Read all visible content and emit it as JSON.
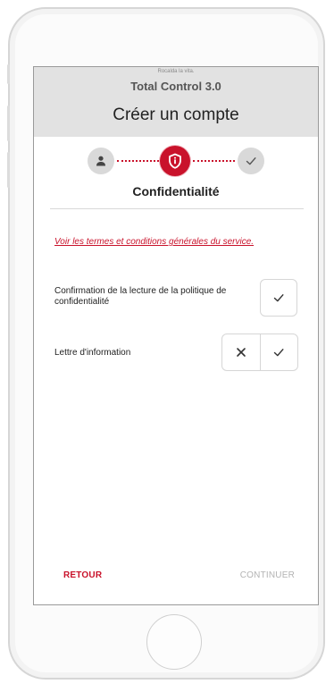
{
  "status_bar": {
    "text": "Rocalda la vita."
  },
  "app": {
    "title": "Total Control 3.0"
  },
  "page": {
    "title": "Créer un compte"
  },
  "stepper": {
    "steps": [
      {
        "icon": "user-icon",
        "state": "done"
      },
      {
        "icon": "shield-icon",
        "state": "active"
      },
      {
        "icon": "check-icon",
        "state": "pending"
      }
    ],
    "current_label": "Confidentialité"
  },
  "terms": {
    "link_text": "Voir les termes et conditions générales du service."
  },
  "rows": {
    "privacy": {
      "label": "Confirmation de la lecture de la politique de confidentialité"
    },
    "newsletter": {
      "label": "Lettre d'information"
    }
  },
  "footer": {
    "back_label": "RETOUR",
    "continue_label": "CONTINUER"
  },
  "colors": {
    "accent": "#c9122b",
    "header_bg": "#e2e2e2",
    "disabled_text": "#b3b3b3",
    "step_inactive": "#d9d9d9"
  }
}
